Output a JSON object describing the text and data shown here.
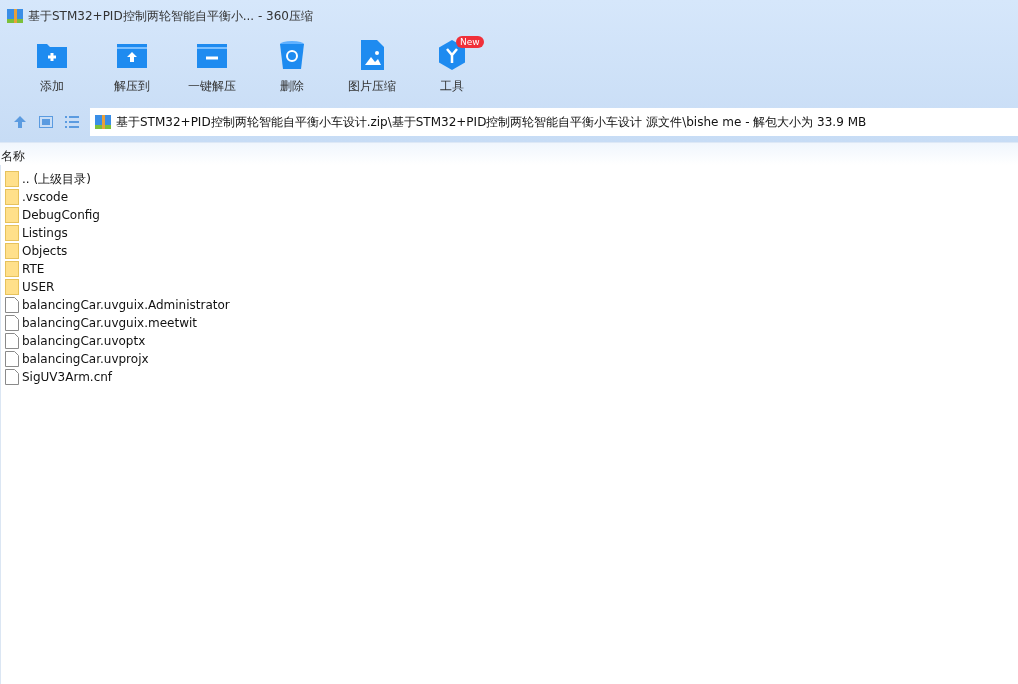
{
  "window": {
    "title": "基于STM32+PID控制两轮智能自平衡小... - 360压缩"
  },
  "toolbar": [
    {
      "kind": "add",
      "label": "添加"
    },
    {
      "kind": "extract-to",
      "label": "解压到"
    },
    {
      "kind": "extract",
      "label": "一键解压"
    },
    {
      "kind": "delete",
      "label": "删除"
    },
    {
      "kind": "image",
      "label": "图片压缩"
    },
    {
      "kind": "tools",
      "label": "工具",
      "badge": "New"
    }
  ],
  "address": {
    "path": "基于STM32+PID控制两轮智能自平衡小车设计.zip\\基于STM32+PID控制两轮智能自平衡小车设计 源文件\\bishe me - 解包大小为 33.9 MB"
  },
  "table": {
    "columns": [
      "名称"
    ],
    "rows": [
      {
        "kind": "folder",
        "name": ".. (上级目录)"
      },
      {
        "kind": "folder",
        "name": ".vscode"
      },
      {
        "kind": "folder",
        "name": "DebugConfig"
      },
      {
        "kind": "folder",
        "name": "Listings"
      },
      {
        "kind": "folder",
        "name": "Objects"
      },
      {
        "kind": "folder",
        "name": "RTE"
      },
      {
        "kind": "folder",
        "name": "USER"
      },
      {
        "kind": "file",
        "name": "balancingCar.uvguix.Administrator"
      },
      {
        "kind": "file",
        "name": "balancingCar.uvguix.meetwit"
      },
      {
        "kind": "file",
        "name": "balancingCar.uvoptx"
      },
      {
        "kind": "file",
        "name": "balancingCar.uvprojx"
      },
      {
        "kind": "file",
        "name": "SigUV3Arm.cnf"
      }
    ]
  }
}
